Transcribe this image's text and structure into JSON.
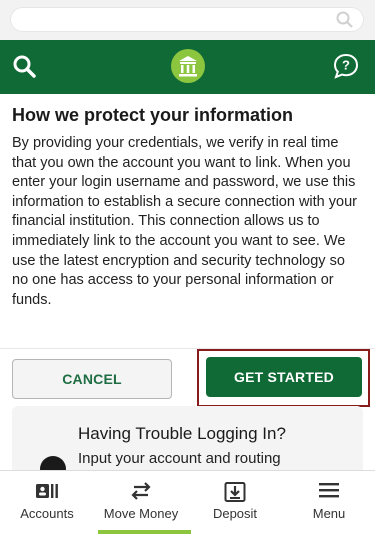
{
  "search": {
    "placeholder": ""
  },
  "content": {
    "title": "How we protect your information",
    "body": "By providing your credentials, we verify in real time that you own the account you want to link. When you enter your login username and password, we use this information to establish a secure connection with your financial institution. This connection allows us to immediately link to the account you want to see. We use the latest encryption and security technology so no one has access to your personal information or funds."
  },
  "actions": {
    "cancel": "CANCEL",
    "start": "GET STARTED"
  },
  "trouble": {
    "title": "Having Trouble Logging In?",
    "text": "Input your account and routing"
  },
  "nav": {
    "items": [
      {
        "label": "Accounts",
        "icon": "accounts-icon"
      },
      {
        "label": "Move Money",
        "icon": "transfer-arrows-icon"
      },
      {
        "label": "Deposit",
        "icon": "deposit-icon"
      },
      {
        "label": "Menu",
        "icon": "hamburger-icon"
      }
    ],
    "active": "Move Money"
  },
  "colors": {
    "brand_green": "#0f6a35",
    "accent_lime": "#8cc63f",
    "highlight": "#8a1b1b"
  }
}
